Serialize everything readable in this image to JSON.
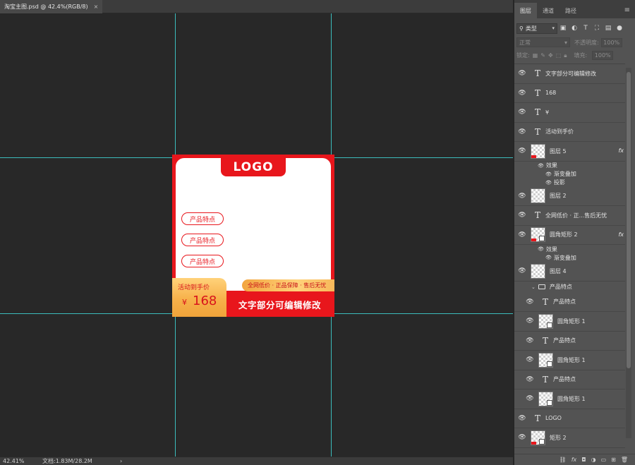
{
  "document": {
    "tab_title": "淘宝主图.psd @ 42.4%(RGB/8)",
    "close_glyph": "×"
  },
  "artwork": {
    "logo": "LOGO",
    "features": [
      "产品特点",
      "产品特点",
      "产品特点"
    ],
    "price_label": "活动到手价",
    "currency": "¥",
    "price": "168",
    "guarantee": "全网低价 · 正品保障 · 售后无忧",
    "headline": "文字部分可编辑修改",
    "colors": {
      "brand_red": "#e8161c",
      "gold": "#f7b14a",
      "guide": "#3fd6d6"
    }
  },
  "statusbar": {
    "zoom": "42.41%",
    "doc_info": "文档:1.83M/28.2M",
    "arrow": "›"
  },
  "panel": {
    "tabs": [
      "图层",
      "通道",
      "路径"
    ],
    "active_tab": "图层",
    "menu_icon": "≡",
    "filter_kind": "类型",
    "filter_icons": [
      "image-filter-icon",
      "adjustment-filter-icon",
      "type-filter-icon",
      "shape-filter-icon",
      "smart-object-filter-icon",
      "filter-toggle-icon"
    ],
    "blend_mode": "正常",
    "opacity_label": "不透明度:",
    "opacity_value": "100%",
    "lock_label": "锁定:",
    "fill_label": "填充:",
    "fill_value": "100%"
  },
  "layers": [
    {
      "kind": "text",
      "name": "文字部分可编辑修改"
    },
    {
      "kind": "text",
      "name": "168"
    },
    {
      "kind": "text",
      "name": "¥"
    },
    {
      "kind": "text",
      "name": "活动到手价"
    },
    {
      "kind": "pixel",
      "name": "图层 5",
      "fx": true,
      "effects_label": "效果",
      "effects": [
        "渐变叠加",
        "投影"
      ]
    },
    {
      "kind": "pixel",
      "name": "图层 2"
    },
    {
      "kind": "text",
      "name": "全网低价 · 正...售后无忧"
    },
    {
      "kind": "shape",
      "name": "圆角矩形 2",
      "fx": true,
      "effects_label": "效果",
      "effects": [
        "渐变叠加"
      ]
    },
    {
      "kind": "pixel",
      "name": "图层 4"
    },
    {
      "kind": "group",
      "name": "产品特点"
    },
    {
      "kind": "text",
      "name": "产品特点",
      "indent": true
    },
    {
      "kind": "shape",
      "name": "圆角矩形 1",
      "indent": true
    },
    {
      "kind": "text",
      "name": "产品特点",
      "indent": true
    },
    {
      "kind": "shape",
      "name": "圆角矩形 1",
      "indent": true
    },
    {
      "kind": "text",
      "name": "产品特点",
      "indent": true
    },
    {
      "kind": "shape",
      "name": "圆角矩形 1",
      "indent": true
    },
    {
      "kind": "text",
      "name": "LOGO"
    },
    {
      "kind": "shape",
      "name": "矩形 2"
    }
  ],
  "footer_icons": [
    "link-layers-icon",
    "fx-icon",
    "mask-icon",
    "adjustment-icon",
    "new-group-icon",
    "new-layer-icon",
    "delete-icon"
  ]
}
